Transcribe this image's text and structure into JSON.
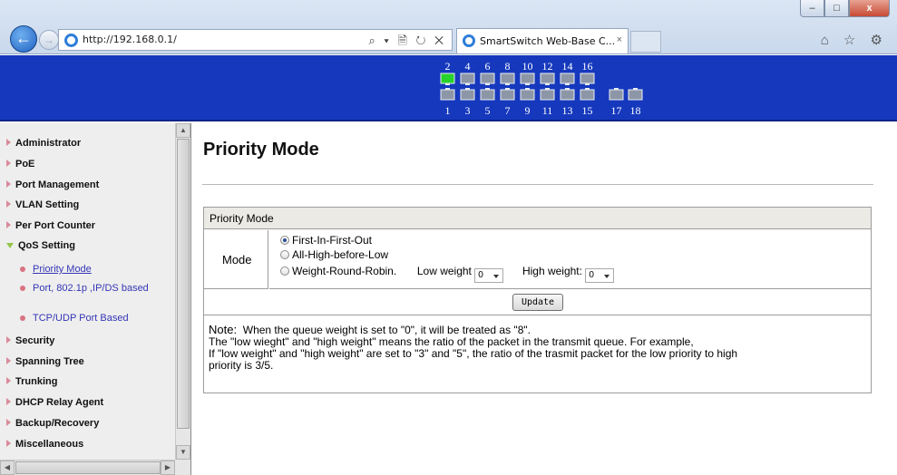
{
  "browser": {
    "url": "http://192.168.0.1/",
    "address_tools": "⌕ ▾ 🗎 ↻ ✕",
    "tab_title": "SmartSwitch Web-Base C...",
    "tab_close": "×",
    "toolbar_icons": "⌂ ☆ ⚙",
    "window_buttons": {
      "minimize": "–",
      "maximize": "□",
      "close": "x"
    }
  },
  "banner": {
    "top_ports": [
      "2",
      "4",
      "6",
      "8",
      "10",
      "12",
      "14",
      "16"
    ],
    "bottom_ports": [
      "1",
      "3",
      "5",
      "7",
      "9",
      "11",
      "13",
      "15",
      "17",
      "18"
    ],
    "active_ports": [
      "2"
    ],
    "colors": {
      "background": "#1538bd",
      "port_active": "#27d32a",
      "port_idle": "#8d96a6"
    }
  },
  "sidebar": {
    "items": [
      {
        "label": "Administrator"
      },
      {
        "label": "PoE"
      },
      {
        "label": "Port Management"
      },
      {
        "label": "VLAN Setting"
      },
      {
        "label": "Per Port Counter"
      },
      {
        "label": "QoS Setting",
        "expanded": true
      },
      {
        "label": "Security"
      },
      {
        "label": "Spanning Tree"
      },
      {
        "label": "Trunking"
      },
      {
        "label": "DHCP Relay Agent"
      },
      {
        "label": "Backup/Recovery"
      },
      {
        "label": "Miscellaneous"
      }
    ],
    "qos_subitems": [
      {
        "label": "Priority Mode",
        "active": true
      },
      {
        "label": "Port, 802.1p ,IP/DS based"
      },
      {
        "label": "TCP/UDP Port Based"
      }
    ]
  },
  "main": {
    "title": "Priority Mode",
    "table_header": "Priority Mode",
    "mode_label": "Mode",
    "options": [
      {
        "label": "First-In-First-Out",
        "selected": true
      },
      {
        "label": "All-High-before-Low",
        "selected": false
      },
      {
        "label": "Weight-Round-Robin.",
        "selected": false
      }
    ],
    "low_weight_label": "Low weight",
    "low_weight_value": "0",
    "high_weight_label": "High weight:",
    "high_weight_value": "0",
    "update_button": "Update",
    "note": {
      "label": "Note:",
      "line1": "When the queue weight is set to \"0\", it will be treated as \"8\".",
      "line2": "The \"low wieght\" and \"high weight\" means the ratio of the packet in the transmit queue. For example,",
      "line3": "If \"low weight\" and \"high weight\" are set to \"3\" and \"5\", the ratio of the trasmit packet for the low priority to high",
      "line4": "priority is 3/5."
    }
  }
}
